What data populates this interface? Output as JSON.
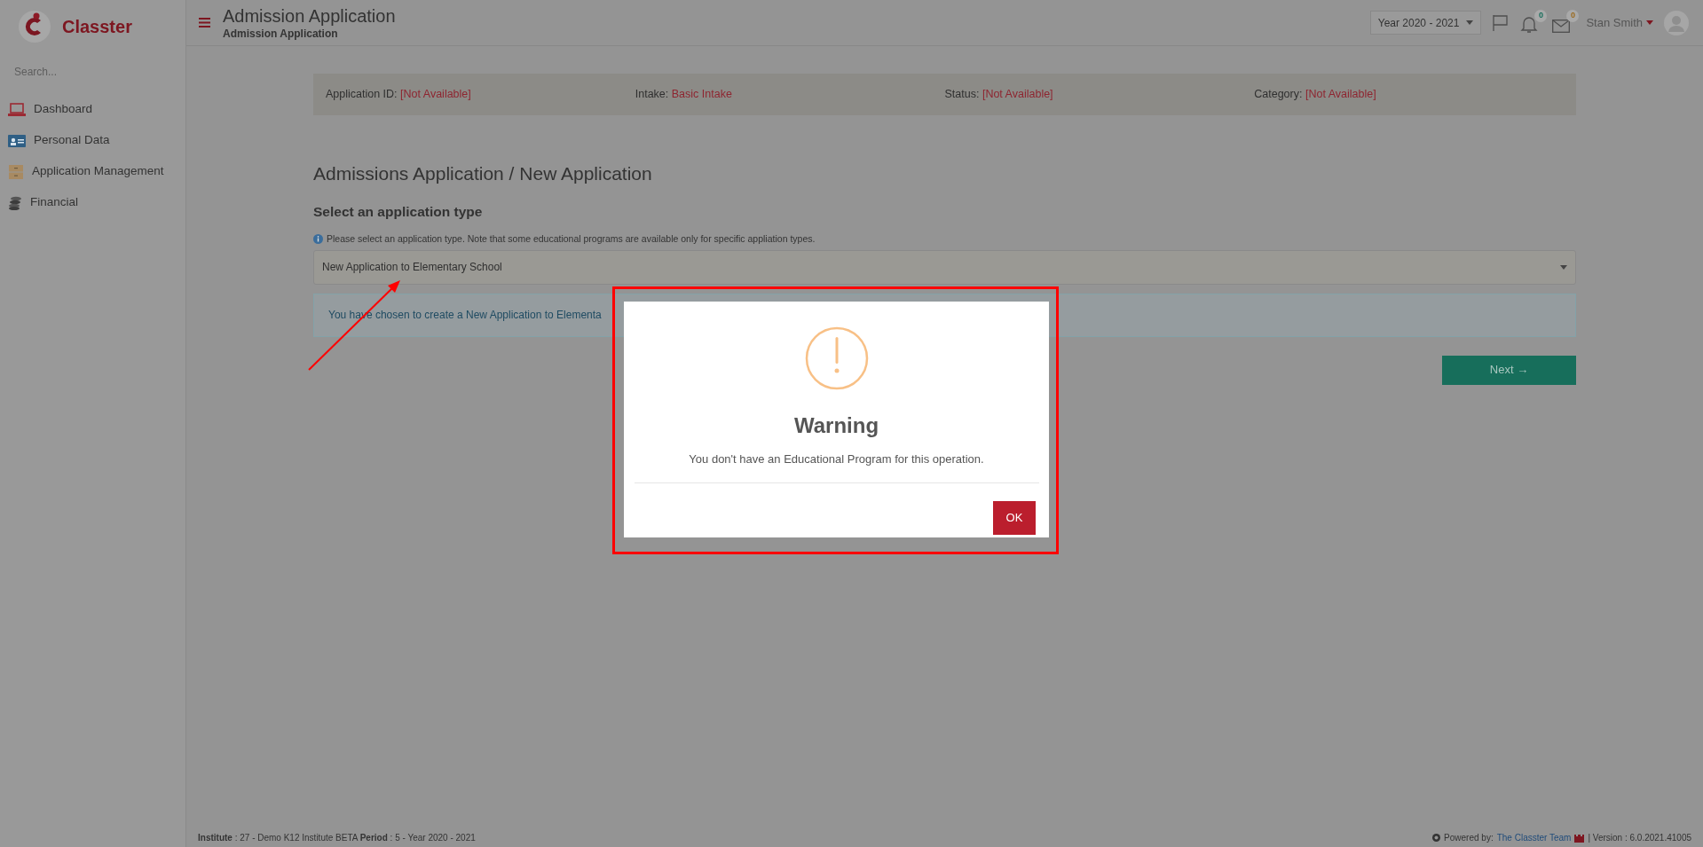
{
  "brand": {
    "name": "Classter"
  },
  "sidebar": {
    "search": {
      "placeholder": "Search..."
    },
    "items": [
      {
        "label": "Dashboard"
      },
      {
        "label": "Personal Data"
      },
      {
        "label": "Application Management"
      },
      {
        "label": "Financial"
      }
    ]
  },
  "header": {
    "title": "Admission Application",
    "subtitle": "Admission Application",
    "year_select": "Year 2020 - 2021",
    "notifications": "0",
    "messages": "0",
    "user": "Stan Smith"
  },
  "info_bar": [
    {
      "label": "Application ID:",
      "value": "[Not Available]"
    },
    {
      "label": "Intake:",
      "value": "Basic Intake"
    },
    {
      "label": "Status:",
      "value": "[Not Available]"
    },
    {
      "label": "Category:",
      "value": "[Not Available]"
    }
  ],
  "page": {
    "heading": "Admissions Application / New Application",
    "section": "Select an application type",
    "hint": "Please select an application type. Note that some educational programs are available only for specific appliation types.",
    "application_type": "New Application to Elementary School",
    "alert": "You have chosen to create a New Application to Elementa",
    "next_button": "Next →"
  },
  "footer": {
    "status": "**Institute** : 27 - Demo K12 Institute BETA **Period** : 5 - Year 2020 - 2021",
    "powered_by": "Powered by:",
    "team_link": "The Classter Team",
    "version": "| Version : 6.0.2021.41005"
  },
  "dialog": {
    "title": "Warning",
    "message": "You don't have an Educational Program for this operation.",
    "ok_button": "OK"
  }
}
